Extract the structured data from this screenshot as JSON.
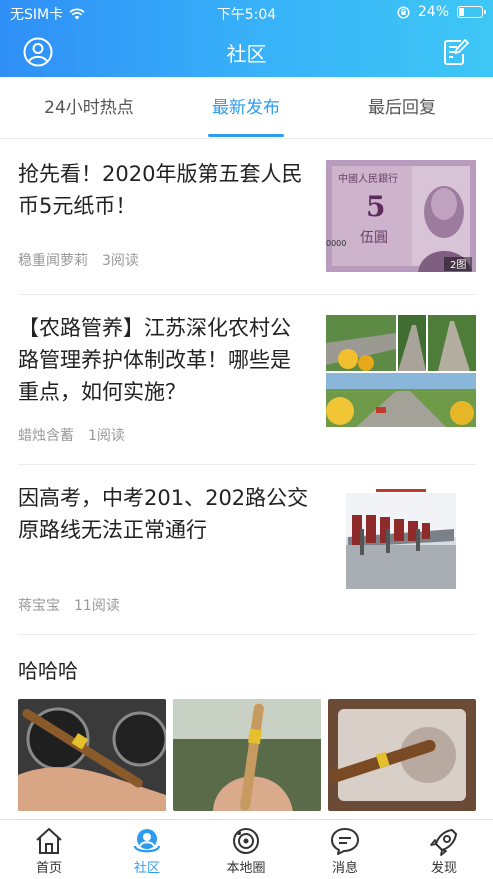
{
  "status_bar": {
    "carrier": "无SIM卡",
    "time": "下午5:04",
    "battery_percent": "24%",
    "battery_level": 0.24
  },
  "navbar": {
    "title": "社区",
    "left_icon": "user-profile-icon",
    "right_icon": "compose-icon"
  },
  "tabs": [
    {
      "label": "24小时热点",
      "active": false
    },
    {
      "label": "最新发布",
      "active": true
    },
    {
      "label": "最后回复",
      "active": false
    }
  ],
  "articles": [
    {
      "title": "抢先看！2020年版第五套人民币5元纸币！",
      "author": "稳重闻萝莉",
      "reads": "3阅读",
      "thumb_badge": "2图",
      "thumb_icon": "banknote-image"
    },
    {
      "title": "【农路管养】江苏深化农村公路管理养护体制改革！哪些是重点，如何实施？",
      "author": "蜡烛含蓄",
      "reads": "1阅读",
      "thumb_icon": "rural-road-collage-image"
    },
    {
      "title": "因高考，中考201、202路公交原路线无法正常通行",
      "author": "蒋宝宝",
      "reads": "11阅读",
      "thumb_icon": "bus-station-image"
    }
  ],
  "gallery_post": {
    "title": "哈哈哈",
    "images": [
      "cigar-car-vent-image",
      "cigar-hand-image",
      "cigar-ashtray-image"
    ]
  },
  "tabbar": [
    {
      "label": "首页",
      "icon": "home-icon",
      "active": false
    },
    {
      "label": "社区",
      "icon": "community-icon",
      "active": true
    },
    {
      "label": "本地圈",
      "icon": "local-circle-icon",
      "active": false
    },
    {
      "label": "消息",
      "icon": "message-icon",
      "active": false
    },
    {
      "label": "发现",
      "icon": "rocket-icon",
      "active": false
    }
  ],
  "colors": {
    "accent": "#2d9cf0",
    "header_start": "#2f8ff7",
    "header_end": "#3ec7f5"
  }
}
